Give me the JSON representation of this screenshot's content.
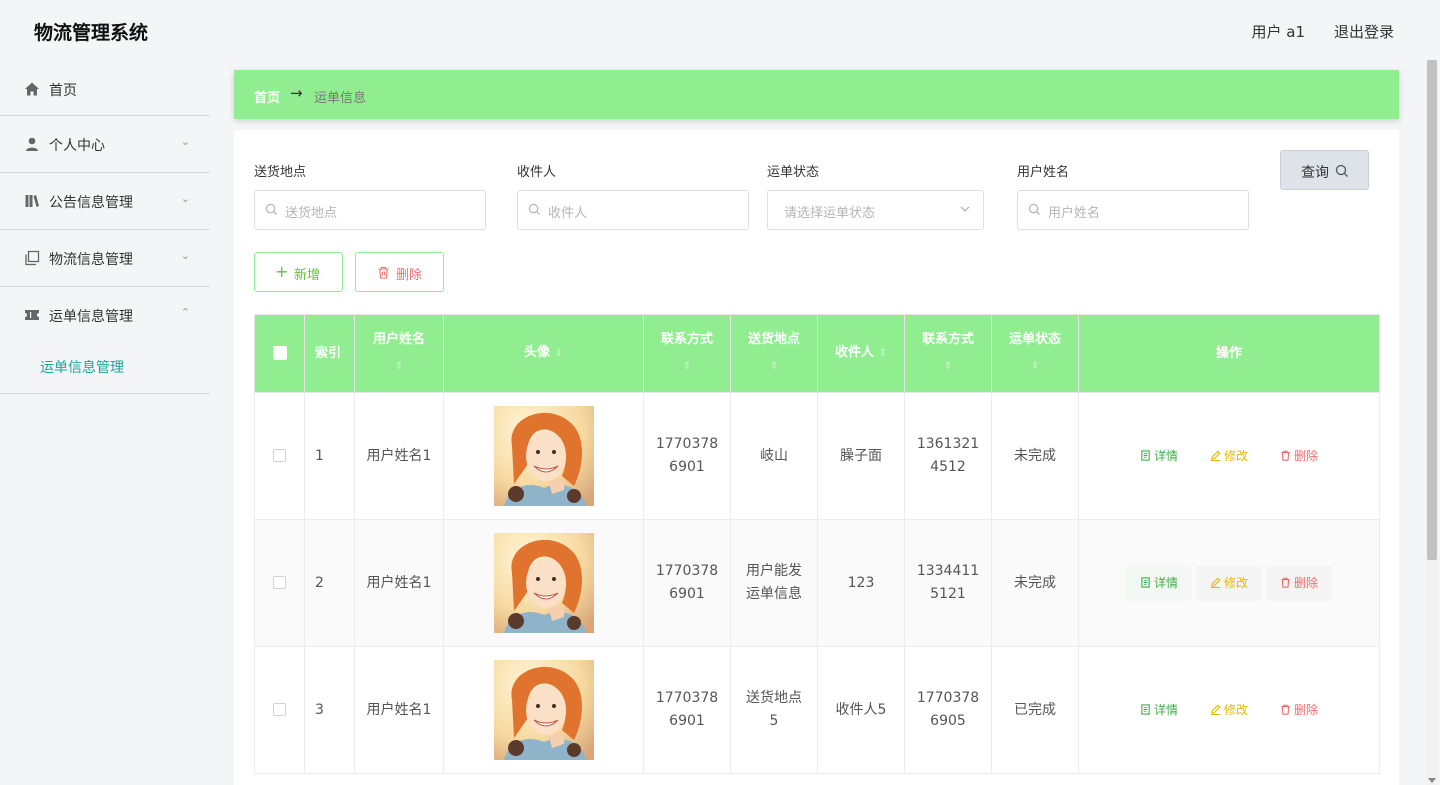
{
  "app": {
    "title": "物流管理系统"
  },
  "header": {
    "user": "用户 a1",
    "logout": "退出登录"
  },
  "sidebar": {
    "items": [
      {
        "label": "首页",
        "icon": "home-icon"
      },
      {
        "label": "个人中心",
        "icon": "user-icon"
      },
      {
        "label": "公告信息管理",
        "icon": "notice-icon"
      },
      {
        "label": "物流信息管理",
        "icon": "copy-icon"
      },
      {
        "label": "运单信息管理",
        "icon": "ticket-icon"
      }
    ],
    "sub_item": "运单信息管理"
  },
  "breadcrumb": {
    "home": "首页",
    "arrow": "→",
    "current": "运单信息"
  },
  "search": {
    "fields": [
      {
        "label": "送货地点",
        "placeholder": "送货地点"
      },
      {
        "label": "收件人",
        "placeholder": "收件人"
      },
      {
        "label": "运单状态",
        "placeholder": "请选择运单状态"
      },
      {
        "label": "用户姓名",
        "placeholder": "用户姓名"
      }
    ],
    "query_button": "查询"
  },
  "actions": {
    "add": "新增",
    "delete": "删除"
  },
  "table": {
    "headers": {
      "index": "索引",
      "username": "用户姓名",
      "avatar": "头像",
      "contact": "联系方式",
      "address": "送货地点",
      "recipient": "收件人",
      "recipient_contact": "联系方式",
      "status": "运单状态",
      "operations": "操作"
    },
    "rows": [
      {
        "index": "1",
        "username": "用户姓名1",
        "contact": "17703786901",
        "address": "岐山",
        "recipient": "臊子面",
        "recipient_contact": "13613214512",
        "status": "未完成"
      },
      {
        "index": "2",
        "username": "用户姓名1",
        "contact": "17703786901",
        "address": "用户能发运单信息",
        "recipient": "123",
        "recipient_contact": "13344115121",
        "status": "未完成"
      },
      {
        "index": "3",
        "username": "用户姓名1",
        "contact": "17703786901",
        "address": "送货地点5",
        "recipient": "收件人5",
        "recipient_contact": "17703786905",
        "status": "已完成"
      }
    ],
    "op_labels": {
      "detail": "详情",
      "edit": "修改",
      "remove": "删除"
    }
  },
  "colors": {
    "accent": "#90ee90",
    "active_menu": "#1aa89a",
    "detail": "#3fae49",
    "edit": "#e6b800",
    "remove": "#f56c6c"
  }
}
